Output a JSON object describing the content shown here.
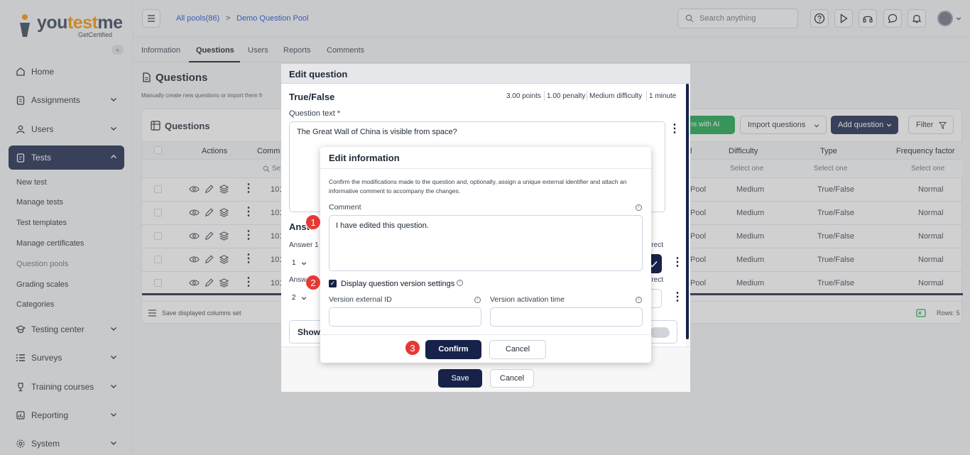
{
  "brand": {
    "logo_word": "youtestme",
    "logo_sub": "GetCertified",
    "collapse_icon": "«"
  },
  "sidebar": {
    "items": [
      {
        "label": "Home",
        "icon": "home-icon",
        "chevron": false
      },
      {
        "label": "Assignments",
        "icon": "clipboard-icon",
        "chevron": true
      },
      {
        "label": "Users",
        "icon": "users-icon",
        "chevron": true
      },
      {
        "label": "Tests",
        "icon": "test-icon",
        "chevron": true,
        "active": true
      },
      {
        "label": "Testing center",
        "icon": "building-icon",
        "chevron": true
      },
      {
        "label": "Surveys",
        "icon": "list-icon",
        "chevron": true
      },
      {
        "label": "Training courses",
        "icon": "trophy-icon",
        "chevron": true
      },
      {
        "label": "Reporting",
        "icon": "report-icon",
        "chevron": true
      },
      {
        "label": "System",
        "icon": "gear-icon",
        "chevron": true
      }
    ],
    "tests_sub": [
      "New test",
      "Manage tests",
      "Test templates",
      "Manage certificates",
      "Question pools",
      "Grading scales",
      "Categories"
    ]
  },
  "header": {
    "crumb_pools": "All pools(86)",
    "crumb_sep": ">",
    "crumb_current": "Demo Question Pool",
    "search_placeholder": "Search anything"
  },
  "tabs": [
    "Information",
    "Questions",
    "Users",
    "Reports",
    "Comments"
  ],
  "page": {
    "title": "Questions",
    "description": "Manually create new questions or import them fr"
  },
  "table": {
    "title": "Questions",
    "ai_button": "ons with AI",
    "import_button": "Import questions",
    "add_button": "Add question",
    "filter_button": "Filter",
    "headers": {
      "actions": "Actions",
      "comment": "Comm",
      "pool": "l",
      "difficulty": "Difficulty",
      "type": "Type",
      "frequency": "Frequency factor"
    },
    "filter_search": "Se",
    "select_one": "Select one",
    "rows": [
      {
        "comment": "101",
        "pool": "Pool",
        "difficulty": "Medium",
        "type": "True/False",
        "frequency": "Normal"
      },
      {
        "comment": "101",
        "pool": "Pool",
        "difficulty": "Medium",
        "type": "True/False",
        "frequency": "Normal"
      },
      {
        "comment": "101",
        "pool": "Pool",
        "difficulty": "Medium",
        "type": "True/False",
        "frequency": "Normal"
      },
      {
        "comment": "101",
        "pool": "Pool",
        "difficulty": "Medium",
        "type": "True/False",
        "frequency": "Normal"
      },
      {
        "comment": "101",
        "pool": "Pool",
        "difficulty": "Medium",
        "type": "True/False",
        "frequency": "Normal"
      }
    ],
    "footer_columns": "Save displayed columns set",
    "footer_rows": "Rows: 5"
  },
  "edit_question": {
    "title": "Edit question",
    "type_title": "True/False",
    "meta": [
      "3.00 points",
      "1.00 penalty",
      "Medium difficulty",
      "1 minute"
    ],
    "question_label": "Question text *",
    "question_text": "The Great Wall of China is visible from space?",
    "answers_heading": "Answ",
    "answer1_label": "Answer 1",
    "answer1_value": "1",
    "answer2_label": "Answ",
    "answer2_value": "2",
    "correct1": "rrect",
    "correct2": "rrect",
    "show_label": "Show",
    "save": "Save",
    "cancel": "Cancel"
  },
  "edit_info": {
    "title": "Edit information",
    "description": "Confirm the modifications made to the question and, optionally, assign a unique external identifier and attach an informative comment to accompany the changes.",
    "comment_label": "Comment",
    "comment_value": "I have edited this question.",
    "checkbox_label": "Display question version settings",
    "checkbox_checked": true,
    "version_id_label": "Version external ID",
    "version_time_label": "Version activation time",
    "version_id_value": "",
    "version_time_value": "",
    "confirm": "Confirm",
    "cancel": "Cancel"
  },
  "steps": [
    "1",
    "2",
    "3"
  ],
  "colors": {
    "navy": "#17224a",
    "green": "#16a34a",
    "step_red": "#e53935",
    "link_blue": "#1d4ed8",
    "brand_orange": "#f39200"
  }
}
